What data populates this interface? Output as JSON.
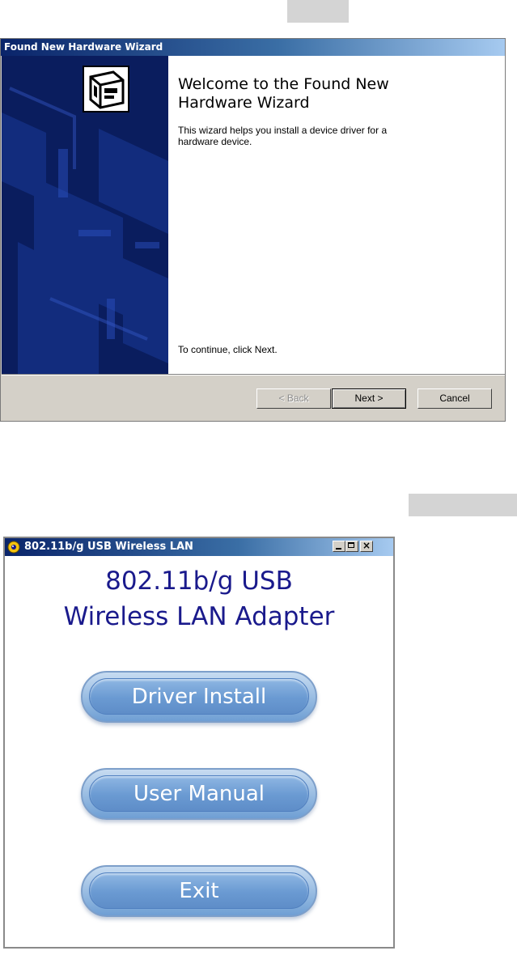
{
  "wizard": {
    "title": "Found New Hardware Wizard",
    "welcome_title": "Welcome to the Found New Hardware Wizard",
    "description": "This wizard helps you install a device driver for a hardware device.",
    "continue_text": "To continue, click Next.",
    "buttons": {
      "back": "< Back",
      "next": "Next >",
      "cancel": "Cancel"
    }
  },
  "autorun": {
    "title": "802.11b/g USB Wireless LAN",
    "heading_line1": "802.11b/g USB",
    "heading_line2": "Wireless LAN Adapter",
    "buttons": {
      "driver_install": "Driver Install",
      "user_manual": "User Manual",
      "exit": "Exit"
    }
  },
  "colors": {
    "title_bar_dark": "#0a246a",
    "wizard_side_panel": "#0a1d5e",
    "heading_text": "#1a1a8c",
    "pill_button": "#6f9fd4"
  },
  "icons": {
    "wizard_badge": "hardware-card-icon",
    "autorun_app": "app-icon"
  }
}
